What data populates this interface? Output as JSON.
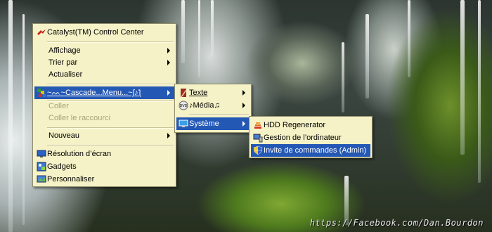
{
  "desktop_menu": {
    "items": [
      {
        "label": "Catalyst(TM) Control Center",
        "icon": "catalyst-icon"
      },
      {
        "label": "Affichage",
        "has_submenu": true
      },
      {
        "label": "Trier par",
        "has_submenu": true
      },
      {
        "label": "Actualiser"
      },
      {
        "label": "~ᨓ~Cascade...Menu...~ʃ♪ƪ",
        "icon": "cascade-menu-icon",
        "has_submenu": true,
        "highlighted": true
      },
      {
        "label": "Coller",
        "disabled": true
      },
      {
        "label": "Coller le raccourci",
        "disabled": true
      },
      {
        "label": "Nouveau",
        "has_submenu": true
      },
      {
        "label": "Résolution d’écran",
        "icon": "screen-resolution-icon"
      },
      {
        "label": "Gadgets",
        "icon": "gadgets-icon"
      },
      {
        "label": "Personnaliser",
        "icon": "personalize-icon"
      }
    ]
  },
  "cascade_menu": {
    "items": [
      {
        "label": "Texte",
        "icon": "book-icon",
        "has_submenu": true
      },
      {
        "label": "♪Média♫",
        "icon": "dvd-icon",
        "has_submenu": true
      },
      {
        "label": "Système",
        "icon": "monitor-icon",
        "has_submenu": true,
        "highlighted": true
      }
    ]
  },
  "system_menu": {
    "items": [
      {
        "label": "HDD Regenerator",
        "icon": "hdd-regenerator-icon"
      },
      {
        "label": "Gestion de l’ordinateur",
        "icon": "computer-management-icon"
      },
      {
        "label": "Invite de commandes (Admin)",
        "icon": "uac-shield-icon",
        "highlighted": true
      }
    ]
  },
  "watermark": "https://Facebook.com/Dan.Bourdon",
  "colors": {
    "menu_bg": "#f5f2c7",
    "highlight": "#2458b5",
    "disabled_text": "#a8a27a"
  }
}
